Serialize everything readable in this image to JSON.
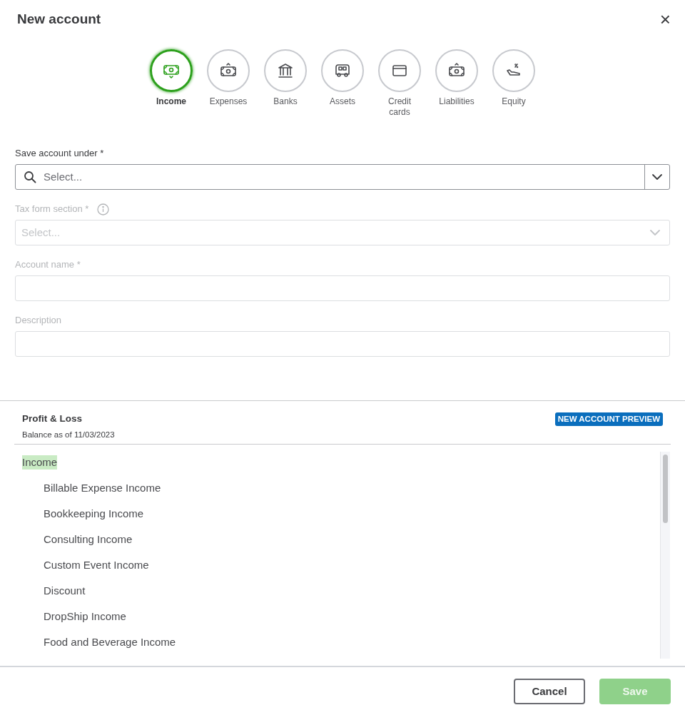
{
  "dialog": {
    "title": "New account",
    "close": "×"
  },
  "account_types": [
    {
      "kind": "income",
      "label": "Income",
      "selected": true
    },
    {
      "kind": "expenses",
      "label": "Expenses",
      "selected": false
    },
    {
      "kind": "banks",
      "label": "Banks",
      "selected": false
    },
    {
      "kind": "assets",
      "label": "Assets",
      "selected": false
    },
    {
      "kind": "credit",
      "label": "Credit cards",
      "selected": false
    },
    {
      "kind": "liabilities",
      "label": "Liabilities",
      "selected": false
    },
    {
      "kind": "equity",
      "label": "Equity",
      "selected": false
    }
  ],
  "fields": [
    {
      "kind": "search-select",
      "label": "Save account under *",
      "placeholder": "Select...",
      "disabled": false
    },
    {
      "kind": "select",
      "label": "Tax form section *",
      "info": true,
      "placeholder": "Select...",
      "disabled": true
    },
    {
      "kind": "text",
      "label": "Account name *",
      "disabled": true
    },
    {
      "kind": "text",
      "label": "Description",
      "disabled": true
    }
  ],
  "preview": {
    "title": "Profit & Loss",
    "subtitle": "Balance as of 11/03/2023",
    "badge": "NEW ACCOUNT PREVIEW",
    "tree": [
      {
        "label": "Income",
        "selected": true,
        "children": [
          {
            "label": "Billable Expense Income",
            "selected": false
          },
          {
            "label": "Bookkeeping Income",
            "selected": false
          },
          {
            "label": "Consulting Income",
            "selected": false
          },
          {
            "label": "Custom Event Income",
            "selected": false
          },
          {
            "label": "Discount",
            "selected": false
          },
          {
            "label": "DropShip Income",
            "selected": false
          },
          {
            "label": "Food and Beverage Income",
            "selected": false
          }
        ]
      }
    ]
  },
  "buttons": [
    {
      "label": "Cancel",
      "kind": "secondary",
      "disabled": false
    },
    {
      "label": "Save",
      "kind": "primary",
      "disabled": true
    }
  ]
}
